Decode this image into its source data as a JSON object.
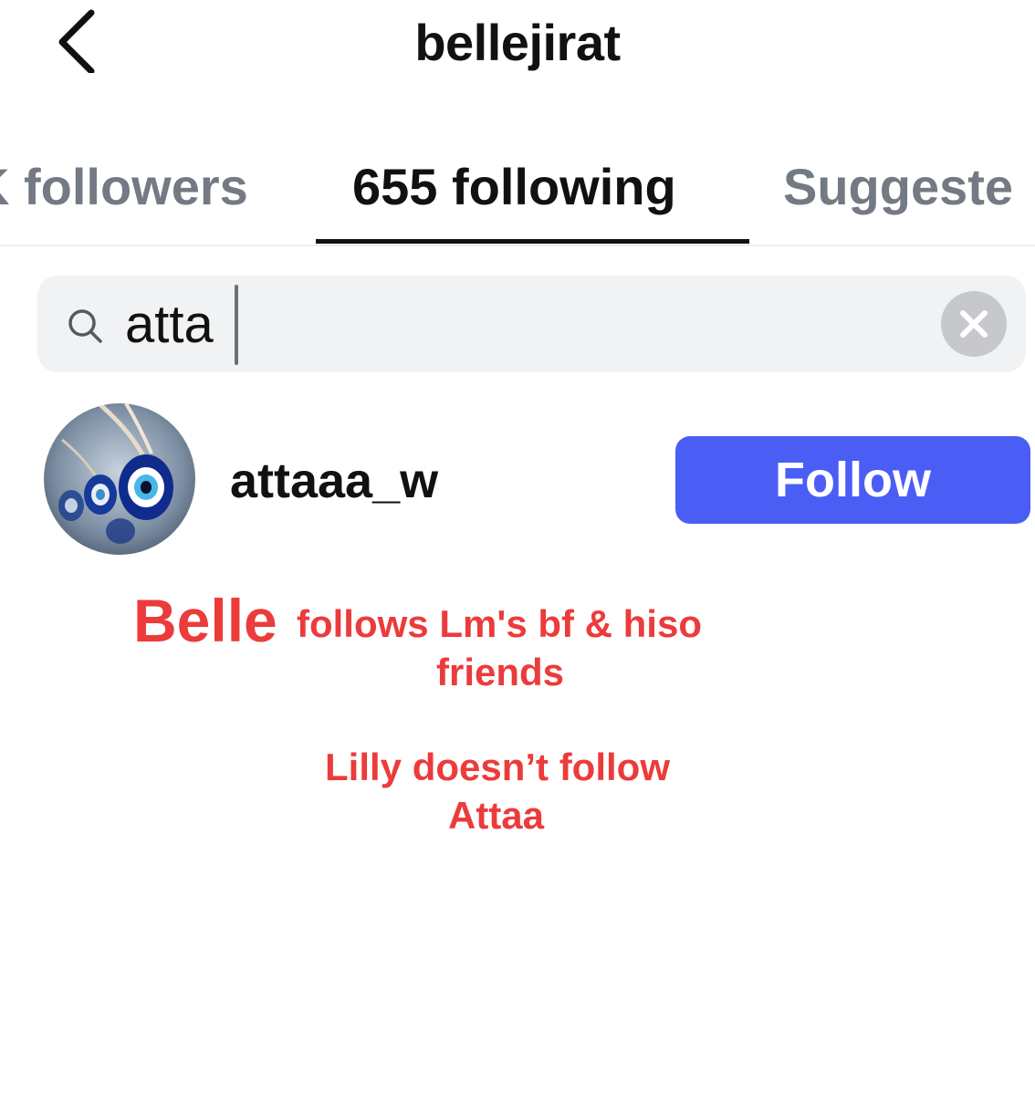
{
  "header": {
    "title": "bellejirat",
    "back_icon": "chevron-left-icon"
  },
  "tabs": [
    {
      "label": "K followers",
      "active": false
    },
    {
      "label": "655 following",
      "active": true
    },
    {
      "label": "Suggeste",
      "active": false
    }
  ],
  "search": {
    "value": "atta",
    "icon": "search-icon",
    "clear_icon": "close-icon"
  },
  "results": [
    {
      "username": "attaaa_w",
      "button_label": "Follow",
      "avatar": "evil-eye-beads"
    }
  ],
  "annotation": {
    "name": "Belle",
    "line1": "follows Lm's bf & hiso",
    "line2": "friends",
    "line3": "Lilly doesn’t follow",
    "line4": "Attaa"
  },
  "colors": {
    "accent": "#4a5ef5",
    "annotation": "#ec3b3b",
    "inactive_tab": "#737a84"
  }
}
